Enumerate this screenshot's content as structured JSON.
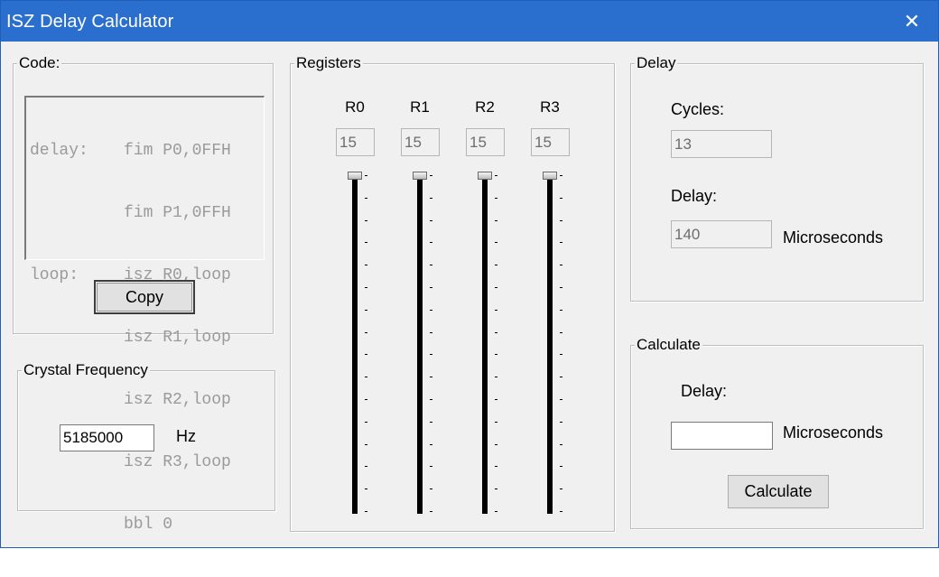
{
  "window": {
    "title": "ISZ Delay Calculator",
    "close_symbol": "✕"
  },
  "code_group": {
    "legend": "Code:",
    "lines": [
      {
        "label": "delay:",
        "code": "fim P0,0FFH"
      },
      {
        "label": "",
        "code": "fim P1,0FFH"
      },
      {
        "label": "loop:",
        "code": "isz R0,loop"
      },
      {
        "label": "",
        "code": "isz R1,loop"
      },
      {
        "label": "",
        "code": "isz R2,loop"
      },
      {
        "label": "",
        "code": "isz R3,loop"
      },
      {
        "label": "",
        "code": "bbl 0"
      }
    ],
    "copy_label": "Copy"
  },
  "crystal_group": {
    "legend": "Crystal Frequency",
    "value": "5185000",
    "unit": "Hz"
  },
  "registers_group": {
    "legend": "Registers",
    "registers": [
      {
        "name": "R0",
        "value": "15",
        "level": 15,
        "max": 15
      },
      {
        "name": "R1",
        "value": "15",
        "level": 15,
        "max": 15
      },
      {
        "name": "R2",
        "value": "15",
        "level": 15,
        "max": 15
      },
      {
        "name": "R3",
        "value": "15",
        "level": 15,
        "max": 15
      }
    ]
  },
  "delay_group": {
    "legend": "Delay",
    "cycles_label": "Cycles:",
    "cycles_value": "13",
    "delay_label": "Delay:",
    "delay_value": "140",
    "unit": "Microseconds"
  },
  "calculate_group": {
    "legend": "Calculate",
    "delay_label": "Delay:",
    "delay_value": "",
    "unit": "Microseconds",
    "button_label": "Calculate"
  },
  "colors": {
    "titlebar": "#2b6fce",
    "window_bg": "#f0f0f0",
    "slider_track": "#000000"
  }
}
